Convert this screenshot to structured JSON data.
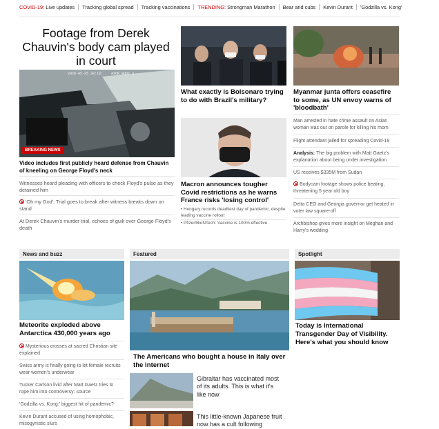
{
  "topbar": {
    "covid_label": "COVID-19:",
    "covid_links": [
      "Live updates",
      "Tracking global spread",
      "Tracking vaccinations"
    ],
    "trending_label": "TRENDING:",
    "trending_links": [
      "Strongman Marathon",
      "Bear and cubs",
      "Kevin Durant",
      "'Godzilla vs. Kong'"
    ]
  },
  "lead": {
    "headline": "Footage from Derek Chauvin's body cam played in court",
    "video_timestamp": "2020-05-25 20:18:... AXON BODY 3 ...",
    "badge": "BREAKING NEWS",
    "caption": "Video includes first publicly heard defense from Chauvin of kneeling on George Floyd's neck",
    "related": [
      {
        "text": "Witnesses heard pleading with officers to check Floyd's pulse as they detained him",
        "video": false
      },
      {
        "text": "'Oh my God': Trial goes to break after witness breaks down on stand",
        "video": true
      },
      {
        "text": "At Derek Chauvin's murder trial, echoes of guilt over George Floyd's death",
        "video": false
      }
    ]
  },
  "col2": {
    "story1": "What exactly is Bolsonaro trying to do with Brazil's military?",
    "story2": "Macron announces tougher Covid restrictions as he warns France risks 'losing control'",
    "bullets": [
      "Hungary records deadliest day of pandemic, despite leading vaccine rollout",
      "Pfizer/BioNTech: Vaccine is 100% effective"
    ]
  },
  "col3": {
    "story1": "Myanmar junta offers ceasefire to some, as UN envoy warns of 'bloodbath'",
    "list": [
      {
        "prefix": "",
        "text": "Man arrested in hate crime assault on Asian woman was out on parole for killing his mom",
        "video": false
      },
      {
        "prefix": "",
        "text": "Flight attendant jailed for spreading Covid-19",
        "video": false
      },
      {
        "prefix": "Analysis:",
        "text": "The big problem with Matt Gaetz's explanation about being under investigation",
        "video": false
      },
      {
        "prefix": "",
        "text": "US receives $335M from Sudan",
        "video": false
      },
      {
        "prefix": "",
        "text": "Bodycam footage shows police beating, threatening 5 year old boy",
        "video": true
      },
      {
        "prefix": "",
        "text": "Delta CEO and Georgia governor get heated in voter law square-off",
        "video": false
      },
      {
        "prefix": "",
        "text": "Archbishop gives more insight on Meghan and Harry's wedding",
        "video": false
      }
    ]
  },
  "buzz": {
    "label": "News and buzz",
    "headline": "Meteorite exploded above Antarctica 430,000 years ago",
    "list": [
      {
        "text": "Mysterious crosses at sacred Christian site explained",
        "video": true
      },
      {
        "text": "Swiss army is finally going to let female recruits wear women's underwear",
        "video": false
      },
      {
        "text": "Tucker Carlson livid after Matt Gaetz tries to rope him into controversy: source",
        "video": false
      },
      {
        "text": "'Godzilla vs. Kong:' biggest hit of pandemic?",
        "video": false
      },
      {
        "text": "Kevin Durant accused of using homophobic, misogynistic slurs",
        "video": false
      }
    ]
  },
  "featured": {
    "label": "Featured",
    "headline": "The Americans who bought a house in Italy over the internet",
    "side1": "Gibraltar has vaccinated most of its adults. This is what it's like now",
    "side2": "This little-known Japanese fruit now has a cult following"
  },
  "spotlight": {
    "label": "Spotlight",
    "headline": "Today is International Transgender Day of Visibility. Here's what you should know"
  },
  "colors": {
    "accent": "#cc0000",
    "text": "#0c0c0c",
    "muted": "#595959",
    "section_bg": "#ececec"
  }
}
